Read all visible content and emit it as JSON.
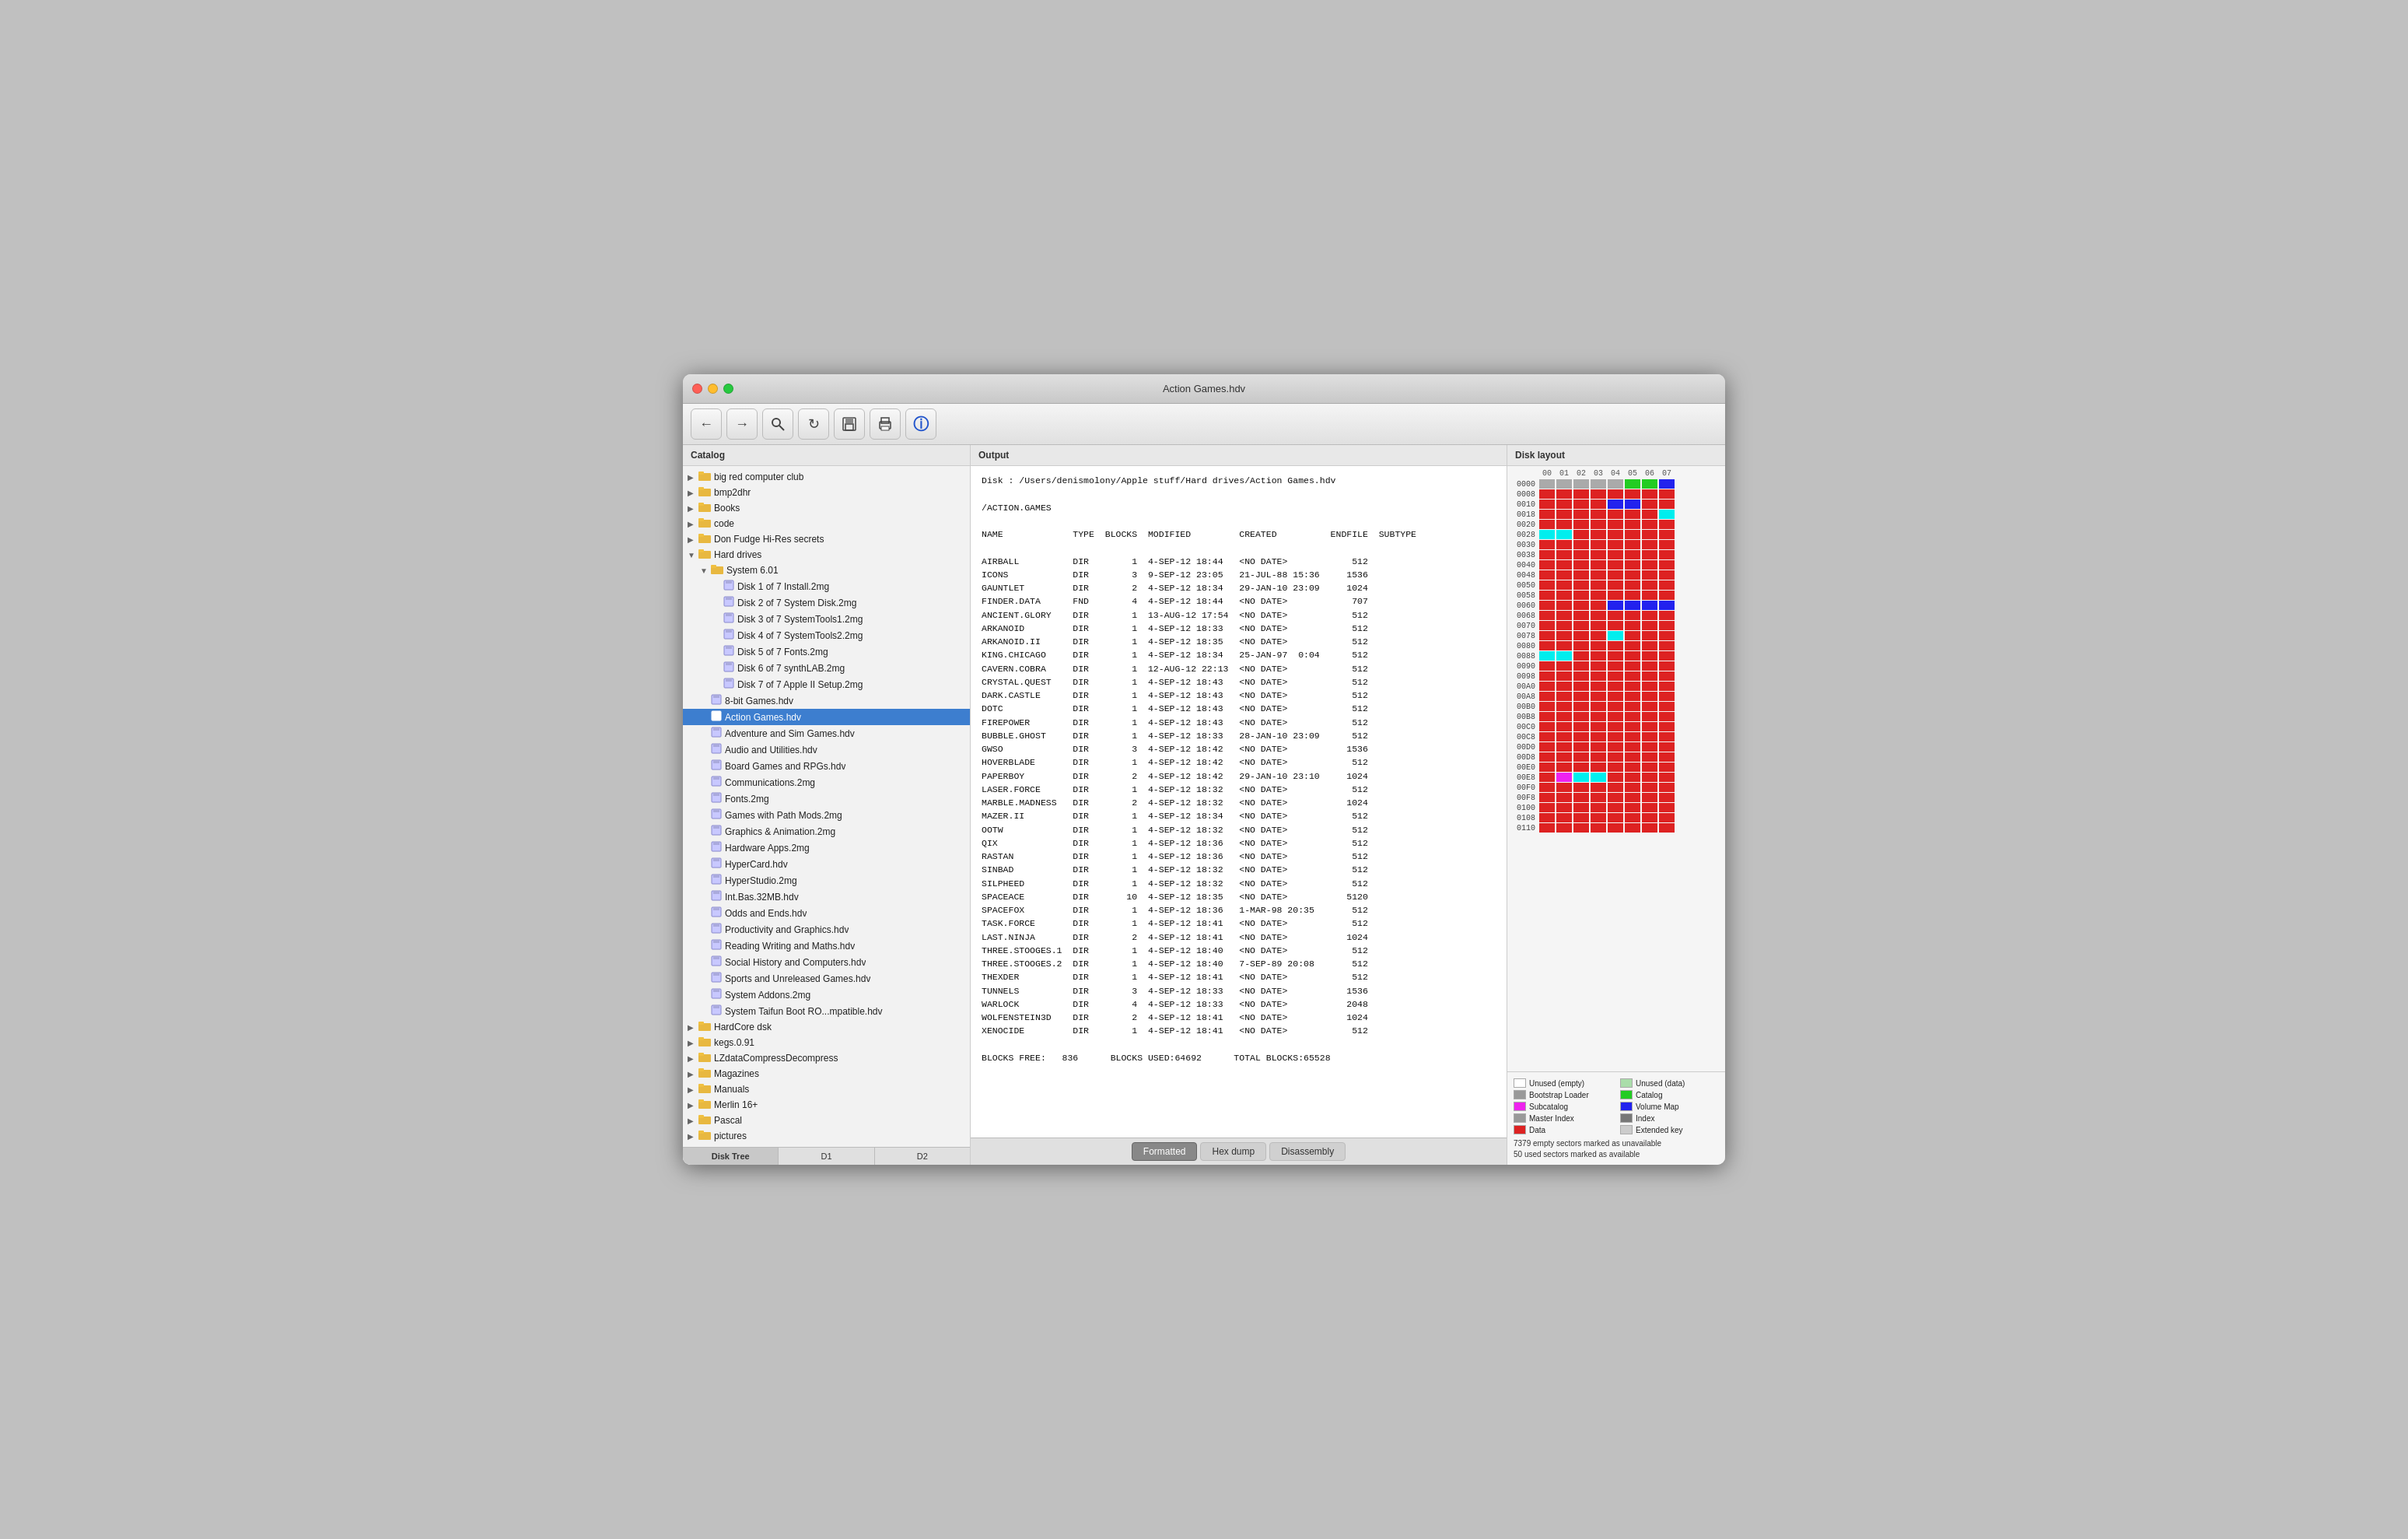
{
  "window": {
    "title": "Action Games.hdv"
  },
  "toolbar": {
    "buttons": [
      {
        "label": "←",
        "name": "back-button"
      },
      {
        "label": "→",
        "name": "forward-button"
      },
      {
        "label": "🔍",
        "name": "search-button"
      },
      {
        "label": "↻",
        "name": "refresh-button"
      },
      {
        "label": "💾",
        "name": "save-button"
      },
      {
        "label": "🖨",
        "name": "print-button"
      },
      {
        "label": "ℹ",
        "name": "info-button"
      }
    ]
  },
  "sidebar": {
    "header": "Catalog",
    "tabs": [
      {
        "label": "Disk Tree",
        "active": true
      },
      {
        "label": "D1"
      },
      {
        "label": "D2"
      }
    ],
    "items": [
      {
        "label": "big red computer club",
        "level": 0,
        "type": "folder",
        "expanded": false
      },
      {
        "label": "bmp2dhr",
        "level": 0,
        "type": "folder",
        "expanded": false
      },
      {
        "label": "Books",
        "level": 0,
        "type": "folder",
        "expanded": false
      },
      {
        "label": "code",
        "level": 0,
        "type": "folder",
        "expanded": false
      },
      {
        "label": "Don Fudge Hi-Res secrets",
        "level": 0,
        "type": "folder",
        "expanded": false
      },
      {
        "label": "Hard drives",
        "level": 0,
        "type": "folder",
        "expanded": true
      },
      {
        "label": "System 6.01",
        "level": 1,
        "type": "folder",
        "expanded": true
      },
      {
        "label": "Disk 1 of 7 Install.2mg",
        "level": 2,
        "type": "file"
      },
      {
        "label": "Disk 2 of 7 System Disk.2mg",
        "level": 2,
        "type": "file"
      },
      {
        "label": "Disk 3 of 7 SystemTools1.2mg",
        "level": 2,
        "type": "file"
      },
      {
        "label": "Disk 4 of 7 SystemTools2.2mg",
        "level": 2,
        "type": "file"
      },
      {
        "label": "Disk 5 of 7 Fonts.2mg",
        "level": 2,
        "type": "file"
      },
      {
        "label": "Disk 6 of 7 synthLAB.2mg",
        "level": 2,
        "type": "file"
      },
      {
        "label": "Disk 7 of 7 Apple II Setup.2mg",
        "level": 2,
        "type": "file"
      },
      {
        "label": "8-bit Games.hdv",
        "level": 1,
        "type": "file"
      },
      {
        "label": "Action Games.hdv",
        "level": 1,
        "type": "file",
        "selected": true
      },
      {
        "label": "Adventure and Sim Games.hdv",
        "level": 1,
        "type": "file"
      },
      {
        "label": "Audio and Utilities.hdv",
        "level": 1,
        "type": "file"
      },
      {
        "label": "Board Games and RPGs.hdv",
        "level": 1,
        "type": "file"
      },
      {
        "label": "Communications.2mg",
        "level": 1,
        "type": "file"
      },
      {
        "label": "Fonts.2mg",
        "level": 1,
        "type": "file"
      },
      {
        "label": "Games with Path Mods.2mg",
        "level": 1,
        "type": "file"
      },
      {
        "label": "Graphics & Animation.2mg",
        "level": 1,
        "type": "file"
      },
      {
        "label": "Hardware Apps.2mg",
        "level": 1,
        "type": "file"
      },
      {
        "label": "HyperCard.hdv",
        "level": 1,
        "type": "file"
      },
      {
        "label": "HyperStudio.2mg",
        "level": 1,
        "type": "file"
      },
      {
        "label": "Int.Bas.32MB.hdv",
        "level": 1,
        "type": "file"
      },
      {
        "label": "Odds and Ends.hdv",
        "level": 1,
        "type": "file"
      },
      {
        "label": "Productivity and Graphics.hdv",
        "level": 1,
        "type": "file"
      },
      {
        "label": "Reading Writing and Maths.hdv",
        "level": 1,
        "type": "file"
      },
      {
        "label": "Social History and Computers.hdv",
        "level": 1,
        "type": "file"
      },
      {
        "label": "Sports and Unreleased Games.hdv",
        "level": 1,
        "type": "file"
      },
      {
        "label": "System Addons.2mg",
        "level": 1,
        "type": "file"
      },
      {
        "label": "System Taifun Boot RO...mpatible.hdv",
        "level": 1,
        "type": "file"
      },
      {
        "label": "HardCore dsk",
        "level": 0,
        "type": "folder",
        "expanded": false
      },
      {
        "label": "kegs.0.91",
        "level": 0,
        "type": "folder",
        "expanded": false
      },
      {
        "label": "LZdataCompressDecompress",
        "level": 0,
        "type": "folder",
        "expanded": false
      },
      {
        "label": "Magazines",
        "level": 0,
        "type": "folder",
        "expanded": false
      },
      {
        "label": "Manuals",
        "level": 0,
        "type": "folder",
        "expanded": false
      },
      {
        "label": "Merlin 16+",
        "level": 0,
        "type": "folder",
        "expanded": false
      },
      {
        "label": "Pascal",
        "level": 0,
        "type": "folder",
        "expanded": false
      },
      {
        "label": "pictures",
        "level": 0,
        "type": "folder",
        "expanded": false
      }
    ]
  },
  "output": {
    "header": "Output",
    "path_line": "Disk : /Users/denismolony/Apple stuff/Hard drives/Action Games.hdv",
    "dir_line": "/ACTION.GAMES",
    "columns": "NAME             TYPE  BLOCKS  MODIFIED         CREATED          ENDFILE  SUBTYPE",
    "entries": [
      "AIRBALL          DIR        1  4-SEP-12 18:44   <NO DATE>            512",
      "ICONS            DIR        3  9-SEP-12 23:05   21-JUL-88 15:36     1536",
      "GAUNTLET         DIR        2  4-SEP-12 18:34   29-JAN-10 23:09     1024",
      "FINDER.DATA      FND        4  4-SEP-12 18:44   <NO DATE>            707",
      "ANCIENT.GLORY    DIR        1  13-AUG-12 17:54  <NO DATE>            512",
      "ARKANOID         DIR        1  4-SEP-12 18:33   <NO DATE>            512",
      "ARKANOID.II      DIR        1  4-SEP-12 18:35   <NO DATE>            512",
      "KING.CHICAGO     DIR        1  4-SEP-12 18:34   25-JAN-97  0:04      512",
      "CAVERN.COBRA     DIR        1  12-AUG-12 22:13  <NO DATE>            512",
      "CRYSTAL.QUEST    DIR        1  4-SEP-12 18:43   <NO DATE>            512",
      "DARK.CASTLE      DIR        1  4-SEP-12 18:43   <NO DATE>            512",
      "DOTC             DIR        1  4-SEP-12 18:43   <NO DATE>            512",
      "FIREPOWER        DIR        1  4-SEP-12 18:43   <NO DATE>            512",
      "BUBBLE.GHOST     DIR        1  4-SEP-12 18:33   28-JAN-10 23:09      512",
      "GWSO             DIR        3  4-SEP-12 18:42   <NO DATE>           1536",
      "HOVERBLADE       DIR        1  4-SEP-12 18:42   <NO DATE>            512",
      "PAPERBOY         DIR        2  4-SEP-12 18:42   29-JAN-10 23:10     1024",
      "LASER.FORCE      DIR        1  4-SEP-12 18:32   <NO DATE>            512",
      "MARBLE.MADNESS   DIR        2  4-SEP-12 18:32   <NO DATE>           1024",
      "MAZER.II         DIR        1  4-SEP-12 18:34   <NO DATE>            512",
      "OOTW             DIR        1  4-SEP-12 18:32   <NO DATE>            512",
      "QIX              DIR        1  4-SEP-12 18:36   <NO DATE>            512",
      "RASTAN           DIR        1  4-SEP-12 18:36   <NO DATE>            512",
      "SINBAD           DIR        1  4-SEP-12 18:32   <NO DATE>            512",
      "SILPHEED         DIR        1  4-SEP-12 18:32   <NO DATE>            512",
      "SPACEACE         DIR       10  4-SEP-12 18:35   <NO DATE>           5120",
      "SPACEFOX         DIR        1  4-SEP-12 18:36   1-MAR-98 20:35       512",
      "TASK.FORCE       DIR        1  4-SEP-12 18:41   <NO DATE>            512",
      "LAST.NINJA       DIR        2  4-SEP-12 18:41   <NO DATE>           1024",
      "THREE.STOOGES.1  DIR        1  4-SEP-12 18:40   <NO DATE>            512",
      "THREE.STOOGES.2  DIR        1  4-SEP-12 18:40   7-SEP-89 20:08       512",
      "THEXDER          DIR        1  4-SEP-12 18:41   <NO DATE>            512",
      "TUNNELS          DIR        3  4-SEP-12 18:33   <NO DATE>           1536",
      "WARLOCK          DIR        4  4-SEP-12 18:33   <NO DATE>           2048",
      "WOLFENSTEIN3D    DIR        2  4-SEP-12 18:41   <NO DATE>           1024",
      "XENOCIDE         DIR        1  4-SEP-12 18:41   <NO DATE>            512"
    ],
    "footer": "BLOCKS FREE:   836      BLOCKS USED:64692      TOTAL BLOCKS:65528",
    "tabs": [
      {
        "label": "Formatted",
        "active": true
      },
      {
        "label": "Hex dump"
      },
      {
        "label": "Disassembly"
      }
    ]
  },
  "disk_layout": {
    "header": "Disk layout",
    "col_labels": [
      "00",
      "01",
      "02",
      "03",
      "04",
      "05",
      "06",
      "07"
    ],
    "rows": [
      {
        "addr": "0000",
        "cells": [
          "gray",
          "gray",
          "gray",
          "gray",
          "gray",
          "green",
          "green",
          "blue"
        ]
      },
      {
        "addr": "0008",
        "cells": [
          "red",
          "red",
          "red",
          "red",
          "red",
          "red",
          "red",
          "red"
        ]
      },
      {
        "addr": "0010",
        "cells": [
          "red",
          "red",
          "red",
          "red",
          "blue",
          "blue",
          "red",
          "red"
        ]
      },
      {
        "addr": "0018",
        "cells": [
          "red",
          "red",
          "red",
          "red",
          "red",
          "red",
          "red",
          "cyan"
        ]
      },
      {
        "addr": "0020",
        "cells": [
          "red",
          "red",
          "red",
          "red",
          "red",
          "red",
          "red",
          "red"
        ]
      },
      {
        "addr": "0028",
        "cells": [
          "cyan",
          "cyan",
          "red",
          "red",
          "red",
          "red",
          "red",
          "red"
        ]
      },
      {
        "addr": "0030",
        "cells": [
          "red",
          "red",
          "red",
          "red",
          "red",
          "red",
          "red",
          "red"
        ]
      },
      {
        "addr": "0038",
        "cells": [
          "red",
          "red",
          "red",
          "red",
          "red",
          "red",
          "red",
          "red"
        ]
      },
      {
        "addr": "0040",
        "cells": [
          "red",
          "red",
          "red",
          "red",
          "red",
          "red",
          "red",
          "red"
        ]
      },
      {
        "addr": "0048",
        "cells": [
          "red",
          "red",
          "red",
          "red",
          "red",
          "red",
          "red",
          "red"
        ]
      },
      {
        "addr": "0050",
        "cells": [
          "red",
          "red",
          "red",
          "red",
          "red",
          "red",
          "red",
          "red"
        ]
      },
      {
        "addr": "0058",
        "cells": [
          "red",
          "red",
          "red",
          "red",
          "red",
          "red",
          "red",
          "red"
        ]
      },
      {
        "addr": "0060",
        "cells": [
          "red",
          "red",
          "red",
          "red",
          "blue",
          "blue",
          "blue",
          "blue"
        ]
      },
      {
        "addr": "0068",
        "cells": [
          "red",
          "red",
          "red",
          "red",
          "red",
          "red",
          "red",
          "red"
        ]
      },
      {
        "addr": "0070",
        "cells": [
          "red",
          "red",
          "red",
          "red",
          "red",
          "red",
          "red",
          "red"
        ]
      },
      {
        "addr": "0078",
        "cells": [
          "red",
          "red",
          "red",
          "red",
          "cyan",
          "red",
          "red",
          "red"
        ]
      },
      {
        "addr": "0080",
        "cells": [
          "red",
          "red",
          "red",
          "red",
          "red",
          "red",
          "red",
          "red"
        ]
      },
      {
        "addr": "0088",
        "cells": [
          "cyan",
          "cyan",
          "red",
          "red",
          "red",
          "red",
          "red",
          "red"
        ]
      },
      {
        "addr": "0090",
        "cells": [
          "red",
          "red",
          "red",
          "red",
          "red",
          "red",
          "red",
          "red"
        ]
      },
      {
        "addr": "0098",
        "cells": [
          "red",
          "red",
          "red",
          "red",
          "red",
          "red",
          "red",
          "red"
        ]
      },
      {
        "addr": "00A0",
        "cells": [
          "red",
          "red",
          "red",
          "red",
          "red",
          "red",
          "red",
          "red"
        ]
      },
      {
        "addr": "00A8",
        "cells": [
          "red",
          "red",
          "red",
          "red",
          "red",
          "red",
          "red",
          "red"
        ]
      },
      {
        "addr": "00B0",
        "cells": [
          "red",
          "red",
          "red",
          "red",
          "red",
          "red",
          "red",
          "red"
        ]
      },
      {
        "addr": "00B8",
        "cells": [
          "red",
          "red",
          "red",
          "red",
          "red",
          "red",
          "red",
          "red"
        ]
      },
      {
        "addr": "00C0",
        "cells": [
          "red",
          "red",
          "red",
          "red",
          "red",
          "red",
          "red",
          "red"
        ]
      },
      {
        "addr": "00C8",
        "cells": [
          "red",
          "red",
          "red",
          "red",
          "red",
          "red",
          "red",
          "red"
        ]
      },
      {
        "addr": "00D0",
        "cells": [
          "red",
          "red",
          "red",
          "red",
          "red",
          "red",
          "red",
          "red"
        ]
      },
      {
        "addr": "00D8",
        "cells": [
          "red",
          "red",
          "red",
          "red",
          "red",
          "red",
          "red",
          "red"
        ]
      },
      {
        "addr": "00E0",
        "cells": [
          "red",
          "red",
          "red",
          "red",
          "red",
          "red",
          "red",
          "red"
        ]
      },
      {
        "addr": "00E8",
        "cells": [
          "red",
          "magenta",
          "cyan",
          "cyan",
          "red",
          "red",
          "red",
          "red"
        ]
      },
      {
        "addr": "00F0",
        "cells": [
          "red",
          "red",
          "red",
          "red",
          "red",
          "red",
          "red",
          "red"
        ]
      },
      {
        "addr": "00F8",
        "cells": [
          "red",
          "red",
          "red",
          "red",
          "red",
          "red",
          "red",
          "red"
        ]
      },
      {
        "addr": "0100",
        "cells": [
          "red",
          "red",
          "red",
          "red",
          "red",
          "red",
          "red",
          "red"
        ]
      },
      {
        "addr": "0108",
        "cells": [
          "red",
          "red",
          "red",
          "red",
          "red",
          "red",
          "red",
          "red"
        ]
      },
      {
        "addr": "0110",
        "cells": [
          "red",
          "red",
          "red",
          "red",
          "red",
          "red",
          "red",
          "red"
        ]
      }
    ],
    "legend": [
      {
        "color": "white",
        "label": "Unused (empty)",
        "border": true
      },
      {
        "color": "#90EE90",
        "label": "Unused (data)"
      },
      {
        "color": "#aaaaaa",
        "label": "Bootstrap Loader"
      },
      {
        "color": "#22cc22",
        "label": "Catalog"
      },
      {
        "color": "#ff44ff",
        "label": "Subcatalog"
      },
      {
        "color": "#2222ff",
        "label": "Volume Map"
      },
      {
        "color": "#aaaaaa",
        "label": "Master Index"
      },
      {
        "color": "#888888",
        "label": "Index"
      },
      {
        "color": "#dd2222",
        "label": "Data"
      },
      {
        "color": "#cccccc",
        "label": "Extended key"
      }
    ],
    "notes": [
      "7379 empty sectors marked as unavailable",
      "50 used sectors marked as available"
    ]
  }
}
